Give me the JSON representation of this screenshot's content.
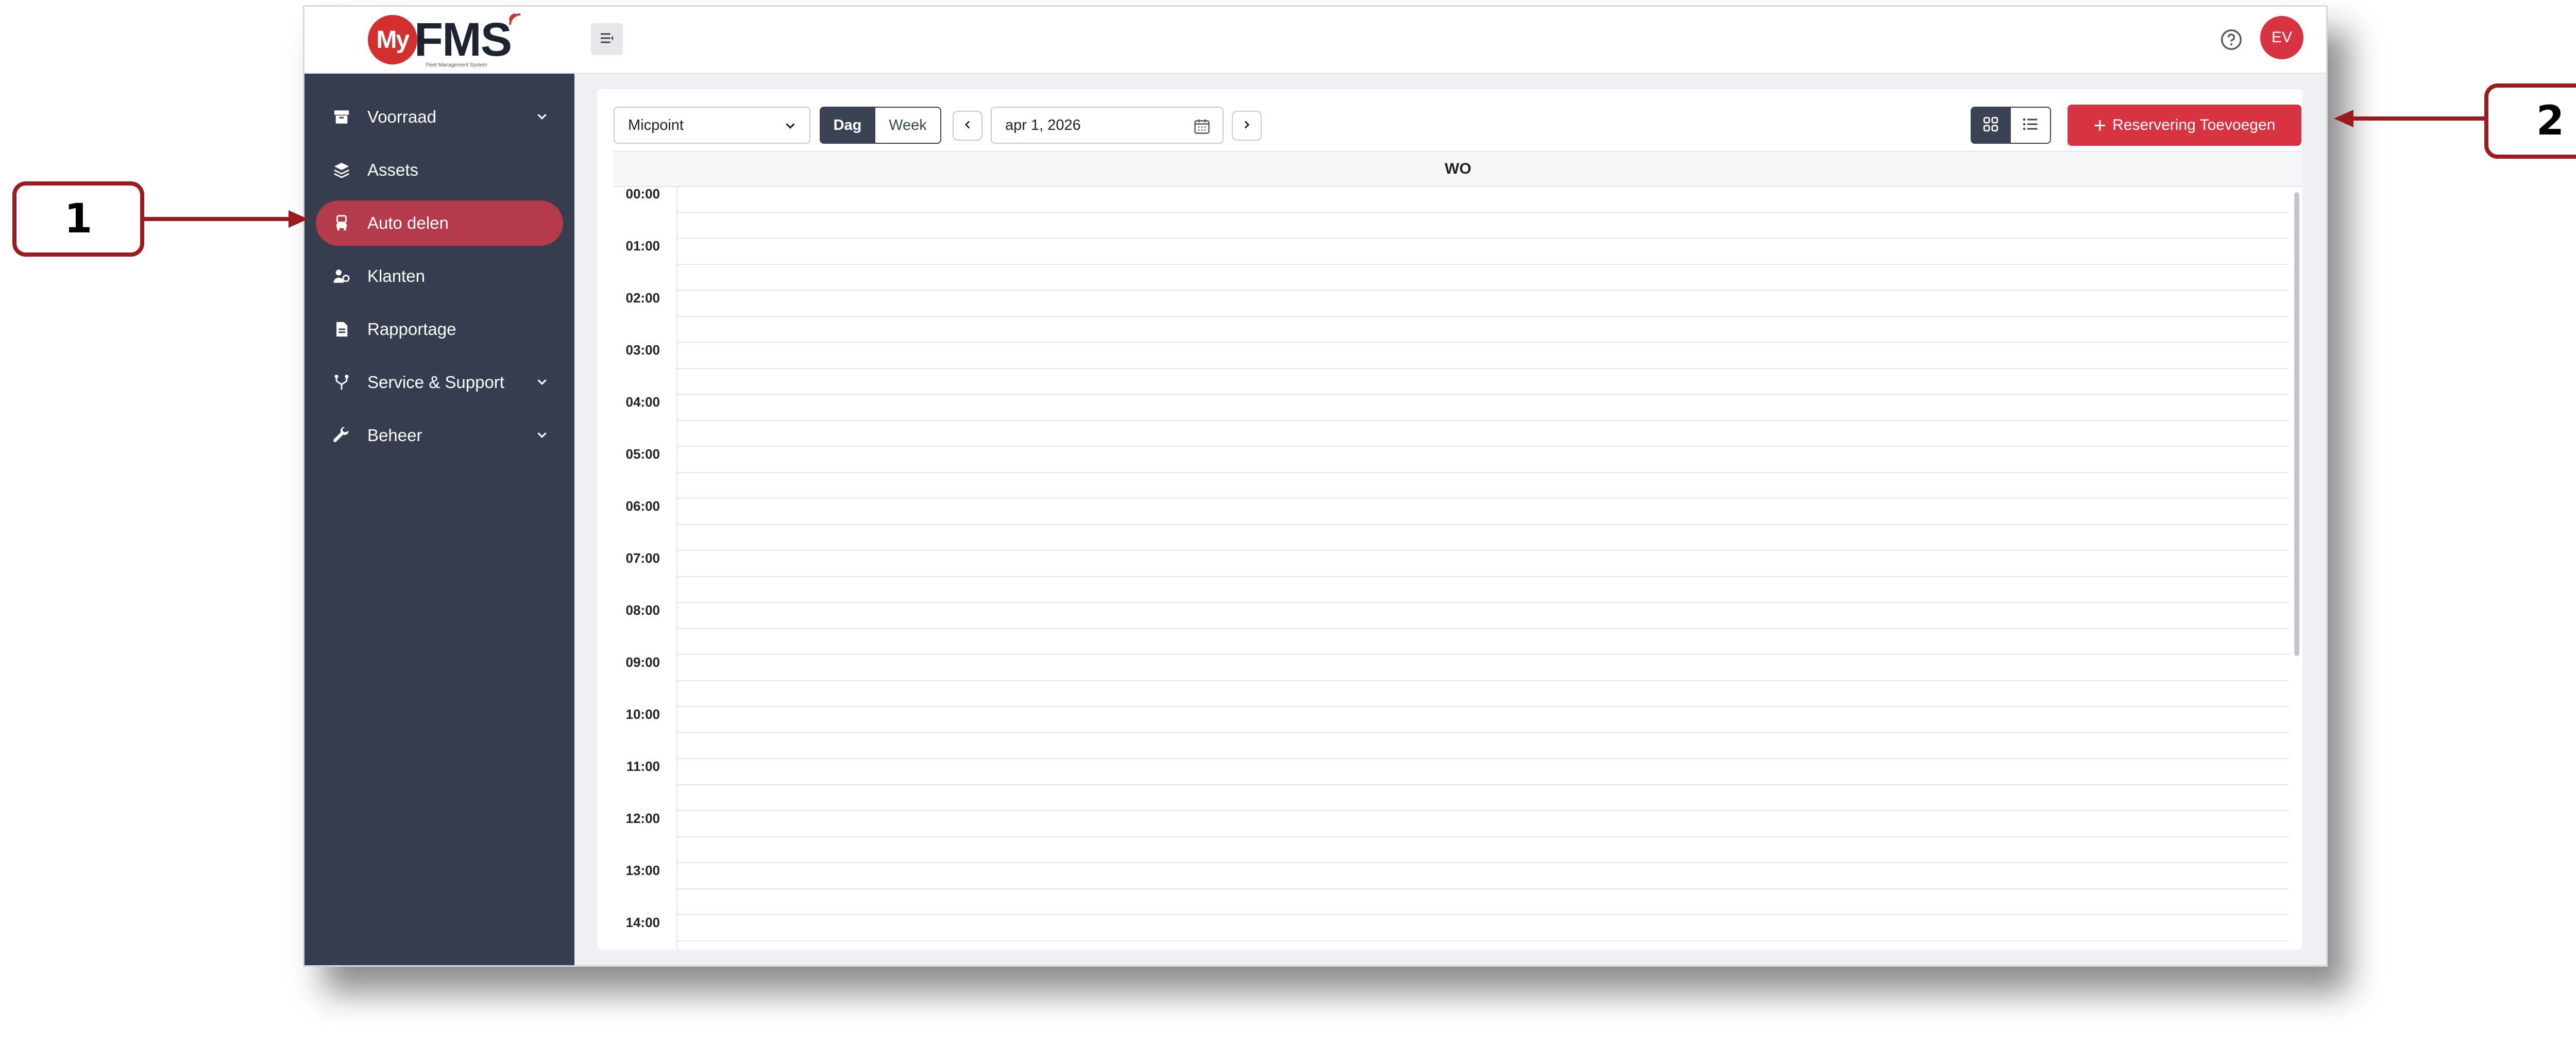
{
  "brand": {
    "logo_prefix": "My",
    "logo_main": "FMS",
    "logo_tagline": "Fleet Management System"
  },
  "sidebar": {
    "items": [
      {
        "label": "Voorraad",
        "icon": "archive-icon",
        "expandable": true,
        "active": false
      },
      {
        "label": "Assets",
        "icon": "layers-icon",
        "expandable": false,
        "active": false
      },
      {
        "label": "Auto delen",
        "icon": "car-share-icon",
        "expandable": false,
        "active": true
      },
      {
        "label": "Klanten",
        "icon": "users-icon",
        "expandable": false,
        "active": false
      },
      {
        "label": "Rapportage",
        "icon": "document-icon",
        "expandable": false,
        "active": false
      },
      {
        "label": "Service & Support",
        "icon": "branch-icon",
        "expandable": true,
        "active": false
      },
      {
        "label": "Beheer",
        "icon": "wrench-icon",
        "expandable": true,
        "active": false
      }
    ]
  },
  "topbar": {
    "avatar_initials": "EV"
  },
  "toolbar": {
    "location_select": "Micpoint",
    "view_day": "Dag",
    "view_week": "Week",
    "date": "apr 1, 2026",
    "add_button": "Reservering Toevoegen"
  },
  "calendar": {
    "day_header": "WO",
    "hours": [
      "00:00",
      "01:00",
      "02:00",
      "03:00",
      "04:00",
      "05:00",
      "06:00",
      "07:00",
      "08:00",
      "09:00",
      "10:00",
      "11:00",
      "12:00",
      "13:00",
      "14:00"
    ]
  },
  "callouts": {
    "one": "1",
    "two": "2"
  },
  "colors": {
    "sidebar_bg": "#353d4e",
    "active_item": "#b53a4b",
    "accent_red": "#d83341",
    "callout_border": "#9b1b1f"
  }
}
